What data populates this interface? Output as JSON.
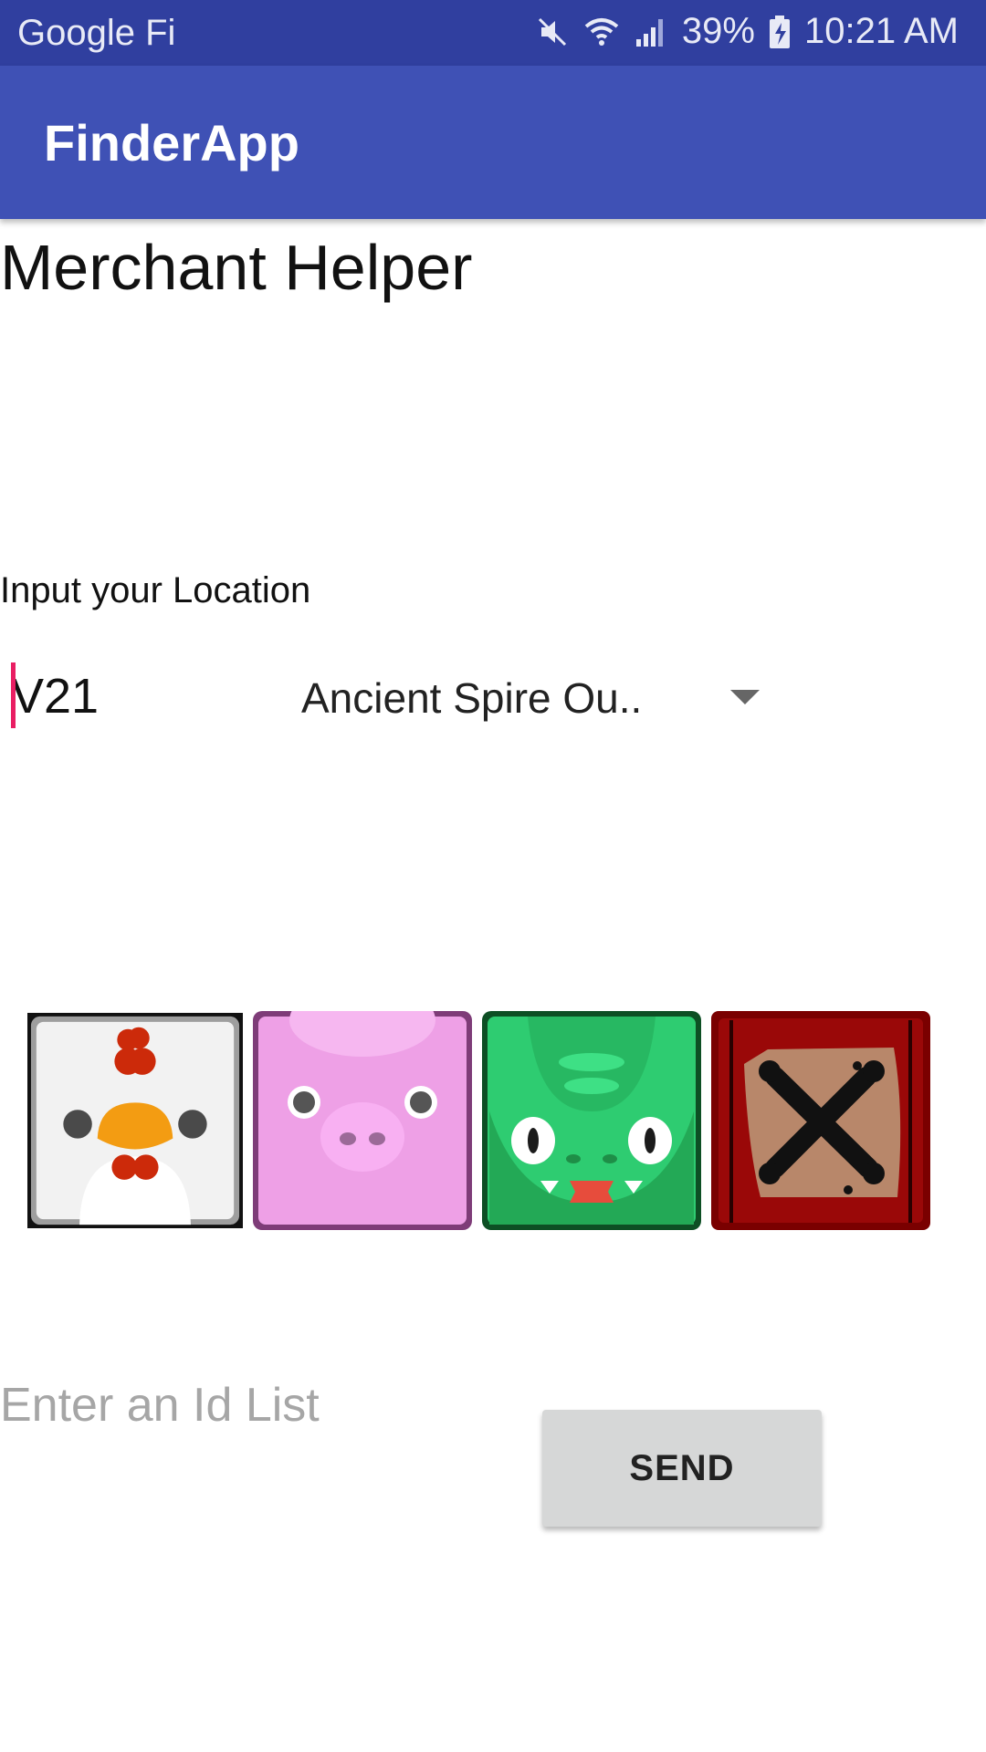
{
  "status_bar": {
    "carrier": "Google Fi",
    "battery": "39%",
    "time": "10:21 AM",
    "icons": [
      "mute-icon",
      "wifi-icon",
      "signal-icon",
      "battery-charging-icon"
    ]
  },
  "app_bar": {
    "title": "FinderApp",
    "color": "#3f51b5"
  },
  "main": {
    "page_title": "Merchant Helper",
    "location_label": "Input your Location",
    "location_value": "V21",
    "location_dropdown": {
      "selected": "Ancient Spire Ou.."
    },
    "tiles": [
      {
        "icon": "chicken-icon"
      },
      {
        "icon": "pig-icon"
      },
      {
        "icon": "green-monster-icon"
      },
      {
        "icon": "treasure-map-icon"
      }
    ],
    "id_list_placeholder": "Enter an Id List",
    "send_label": "SEND"
  }
}
